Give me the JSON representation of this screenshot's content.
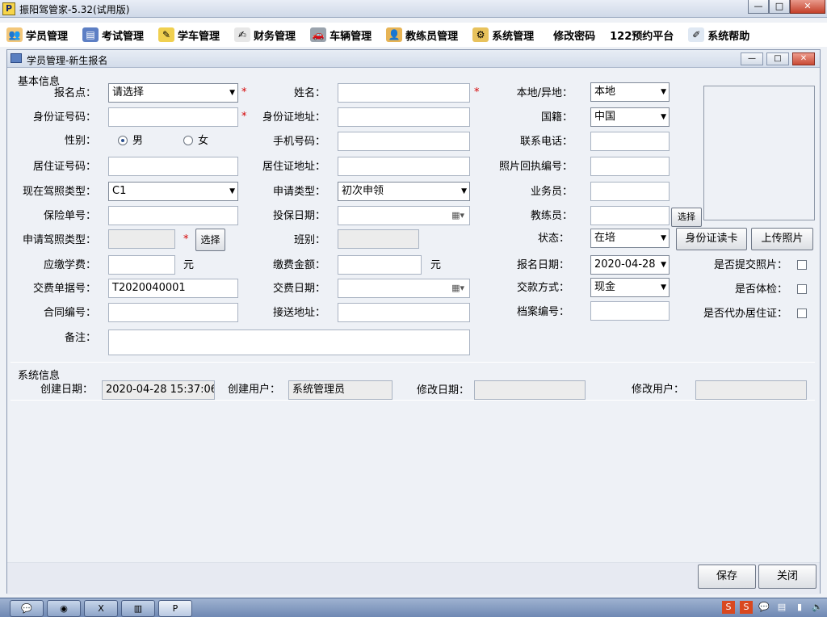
{
  "window": {
    "title": "振阳驾管家-5.32(试用版)",
    "app_icon": "P"
  },
  "menubar": {
    "items": [
      {
        "label": "学员管理",
        "icon": "students-icon"
      },
      {
        "label": "考试管理",
        "icon": "exam-icon"
      },
      {
        "label": "学车管理",
        "icon": "driving-icon"
      },
      {
        "label": "财务管理",
        "icon": "finance-icon"
      },
      {
        "label": "车辆管理",
        "icon": "car-icon"
      },
      {
        "label": "教练员管理",
        "icon": "coach-icon"
      },
      {
        "label": "系统管理",
        "icon": "system-icon"
      },
      {
        "label": "修改密码",
        "icon": ""
      },
      {
        "label": "122预约平台",
        "icon": ""
      },
      {
        "label": "系统帮助",
        "icon": "help-icon"
      }
    ]
  },
  "inner": {
    "title": "学员管理-新生报名"
  },
  "basic": {
    "section_title": "基本信息",
    "signup_point": {
      "label": "报名点：",
      "value": "请选择"
    },
    "name": {
      "label": "姓名：",
      "value": ""
    },
    "local_remote": {
      "label": "本地/异地：",
      "value": "本地"
    },
    "id_number": {
      "label": "身份证号码：",
      "value": ""
    },
    "id_address": {
      "label": "身份证地址：",
      "value": ""
    },
    "nationality": {
      "label": "国籍：",
      "value": "中国"
    },
    "gender": {
      "label": "性别：",
      "male": "男",
      "female": "女",
      "selected": "男"
    },
    "mobile": {
      "label": "手机号码：",
      "value": ""
    },
    "contact_phone": {
      "label": "联系电话：",
      "value": ""
    },
    "residence_no": {
      "label": "居住证号码：",
      "value": ""
    },
    "residence_addr": {
      "label": "居住证地址：",
      "value": ""
    },
    "photo_receipt": {
      "label": "照片回执编号：",
      "value": ""
    },
    "current_license": {
      "label": "现在驾照类型：",
      "value": "C1"
    },
    "apply_type": {
      "label": "申请类型：",
      "value": "初次申领"
    },
    "salesman": {
      "label": "业务员：",
      "value": ""
    },
    "insurance_no": {
      "label": "保险单号：",
      "value": ""
    },
    "insure_date": {
      "label": "投保日期：",
      "value": ""
    },
    "coach": {
      "label": "教练员：",
      "value": "",
      "select_label": "选择"
    },
    "apply_license": {
      "label": "申请驾照类型：",
      "value": "",
      "select_label": "选择"
    },
    "class": {
      "label": "班别：",
      "value": ""
    },
    "status": {
      "label": "状态：",
      "value": "在培"
    },
    "btn_id_read": "身份证读卡",
    "btn_upload_photo": "上传照片",
    "tuition_due": {
      "label": "应缴学费：",
      "value": "",
      "unit": "元"
    },
    "pay_amount": {
      "label": "缴费金额：",
      "value": "",
      "unit": "元"
    },
    "signup_date": {
      "label": "报名日期：",
      "value": "2020-04-28"
    },
    "photo_submitted": {
      "label": "是否提交照片："
    },
    "receipt_no": {
      "label": "交费单据号：",
      "value": "T2020040001"
    },
    "pay_date": {
      "label": "交费日期：",
      "value": ""
    },
    "pay_method": {
      "label": "交款方式：",
      "value": "现金"
    },
    "physical_exam": {
      "label": "是否体检："
    },
    "contract_no": {
      "label": "合同编号：",
      "value": ""
    },
    "pickup_addr": {
      "label": "接送地址：",
      "value": ""
    },
    "archive_no": {
      "label": "档案编号：",
      "value": ""
    },
    "residence_agent": {
      "label": "是否代办居住证："
    },
    "remark": {
      "label": "备注：",
      "value": ""
    }
  },
  "system": {
    "section_title": "系统信息",
    "create_date": {
      "label": "创建日期：",
      "value": "2020-04-28 15:37:06"
    },
    "create_user": {
      "label": "创建用户：",
      "value": "系统管理员"
    },
    "modify_date": {
      "label": "修改日期：",
      "value": ""
    },
    "modify_user": {
      "label": "修改用户：",
      "value": ""
    }
  },
  "footer": {
    "save": "保存",
    "close": "关闭"
  }
}
